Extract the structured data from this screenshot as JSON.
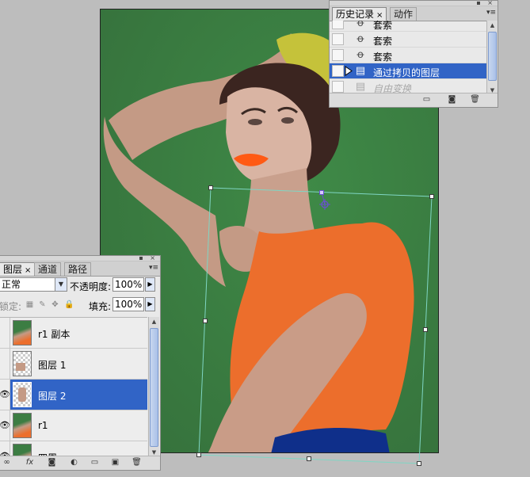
{
  "history_panel": {
    "tabs": [
      {
        "label": "历史记录",
        "close": "×"
      },
      {
        "label": "动作"
      }
    ],
    "steps": [
      {
        "label": "套索",
        "icon": "lasso-icon",
        "state": "normal"
      },
      {
        "label": "套索",
        "icon": "lasso-icon",
        "state": "normal"
      },
      {
        "label": "套索",
        "icon": "lasso-icon",
        "state": "normal"
      },
      {
        "label": "通过拷贝的图层",
        "icon": "layer-copy-icon",
        "state": "selected"
      },
      {
        "label": "自由变换",
        "icon": "free-transform-icon",
        "state": "dimmed"
      }
    ]
  },
  "layers_panel": {
    "tabs": [
      {
        "label": "图层",
        "close": "×"
      },
      {
        "label": "通道"
      },
      {
        "label": "路径"
      }
    ],
    "blend_mode": "正常",
    "opacity_label": "不透明度:",
    "opacity_value": "100%",
    "lock_label": "锁定:",
    "fill_label": "填充:",
    "fill_value": "100%",
    "layers": [
      {
        "name": "r1 副本",
        "visible": false,
        "thumb": "photo",
        "selected": false
      },
      {
        "name": "图层 1",
        "visible": false,
        "thumb": "checker",
        "selected": false
      },
      {
        "name": "图层 2",
        "visible": true,
        "thumb": "checker",
        "selected": true
      },
      {
        "name": "r1",
        "visible": true,
        "thumb": "photo",
        "selected": false
      },
      {
        "name": "四周",
        "visible": true,
        "thumb": "photo",
        "selected": false
      }
    ]
  },
  "colors": {
    "selection": "#3164c6",
    "canvas_bg": "#3c7d43",
    "transform_line": "#7fd6c4"
  }
}
